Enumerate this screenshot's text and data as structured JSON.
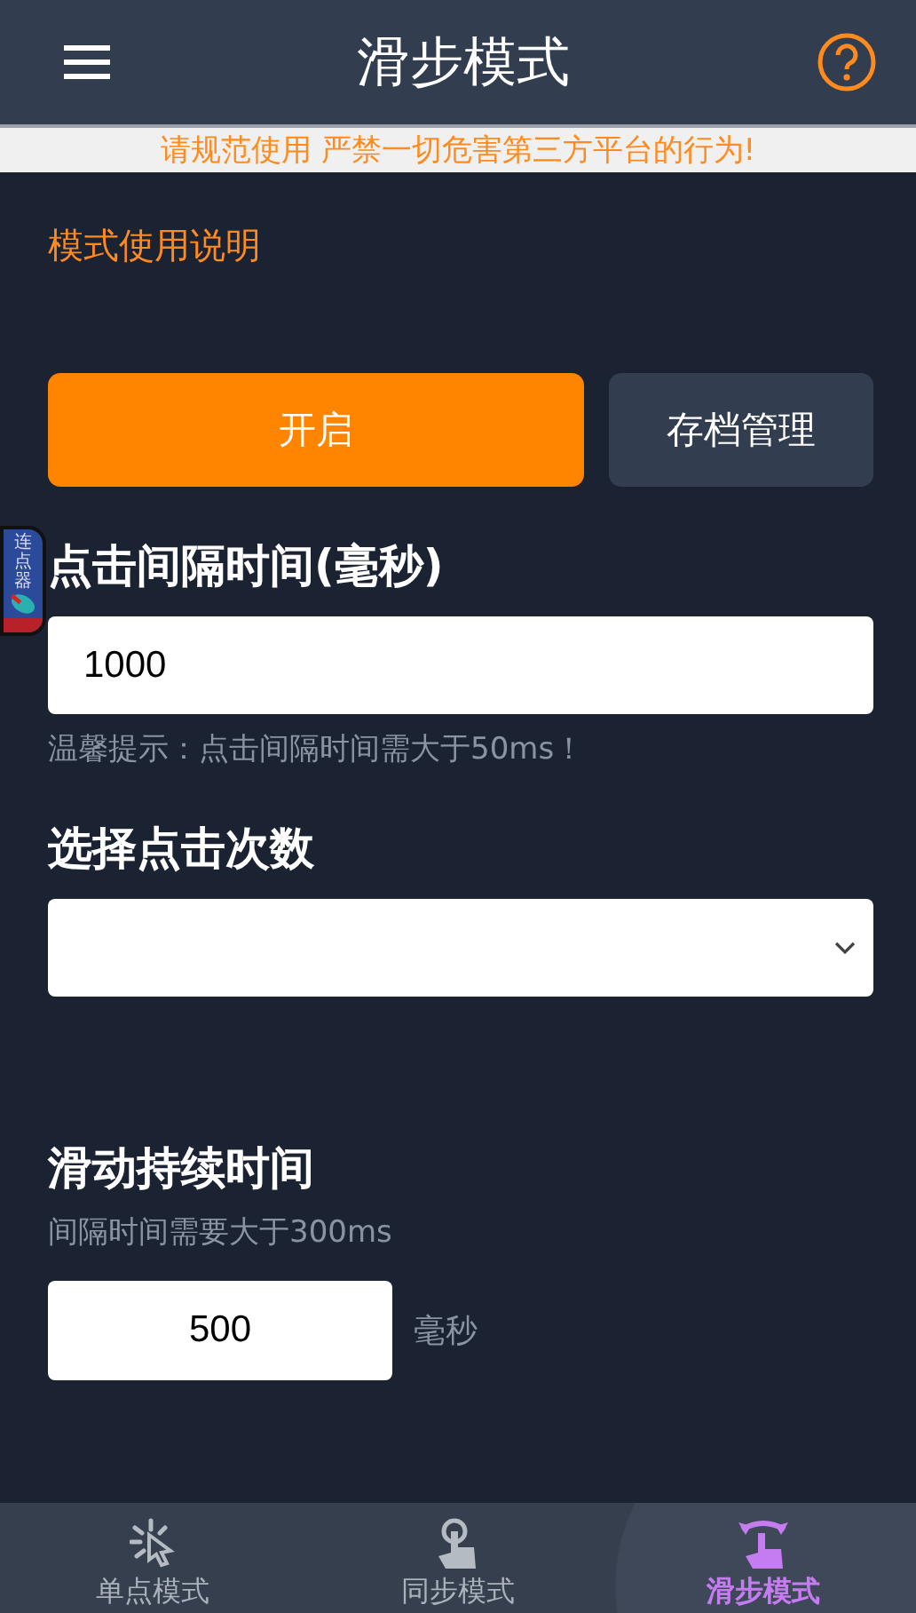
{
  "header": {
    "title": "滑步模式"
  },
  "notice": "请规范使用 严禁一切危害第三方平台的行为!",
  "instructions_link": "模式使用说明",
  "buttons": {
    "start": "开启",
    "archive": "存档管理"
  },
  "floating_widget": {
    "label": "连点器"
  },
  "interval": {
    "label": "点击间隔时间(毫秒)",
    "value": "1000",
    "hint": "温馨提示：点击间隔时间需大于50ms！"
  },
  "click_count": {
    "label": "选择点击次数"
  },
  "swipe_duration": {
    "label": "滑动持续时间",
    "hint": "间隔时间需要大于300ms",
    "value": "500",
    "unit": "毫秒"
  },
  "bottom_nav": [
    {
      "label": "单点模式",
      "kind": "tap",
      "selected": false
    },
    {
      "label": "同步模式",
      "kind": "finger",
      "selected": false
    },
    {
      "label": "滑步模式",
      "kind": "swipe",
      "selected": true
    }
  ]
}
